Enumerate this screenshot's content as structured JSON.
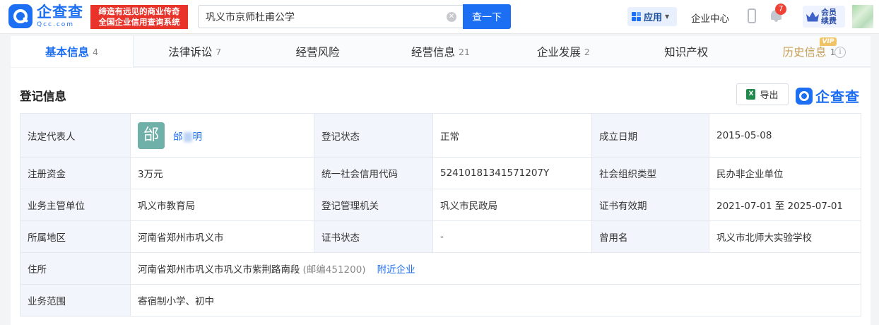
{
  "header": {
    "logo_cn": "企查查",
    "logo_en": "Qcc.com",
    "slogan_line1": "缔造有远见的商业传奇",
    "slogan_line2": "全国企业信用查询系统",
    "search_value": "巩义市京师杜甫公学",
    "search_button": "查一下",
    "app_label": "应用",
    "enterprise_center": "企业中心",
    "notification_count": "7",
    "vip_line1": "会员",
    "vip_line2": "续费"
  },
  "tabs": [
    {
      "label": "基本信息",
      "count": "4"
    },
    {
      "label": "法律诉讼",
      "count": "7"
    },
    {
      "label": "经营风险",
      "count": ""
    },
    {
      "label": "经营信息",
      "count": "21"
    },
    {
      "label": "企业发展",
      "count": "2"
    },
    {
      "label": "知识产权",
      "count": ""
    },
    {
      "label": "历史信息",
      "count": "1"
    }
  ],
  "vip_tag": "VIP",
  "section": {
    "title": "登记信息",
    "export_label": "导出",
    "brand": "企查查"
  },
  "registration": {
    "legal_rep_label": "法定代表人",
    "legal_rep_avatar": "邰",
    "legal_rep_first": "邰",
    "legal_rep_last": "明",
    "reg_status_label": "登记状态",
    "reg_status": "正常",
    "founded_label": "成立日期",
    "founded": "2015-05-08",
    "capital_label": "注册资金",
    "capital": "3万元",
    "credit_code_label": "统一社会信用代码",
    "credit_code": "52410181341571207Y",
    "org_type_label": "社会组织类型",
    "org_type": "民办非企业单位",
    "supervisor_label": "业务主管单位",
    "supervisor": "巩义市教育局",
    "reg_authority_label": "登记管理机关",
    "reg_authority": "巩义市民政局",
    "cert_valid_label": "证书有效期",
    "cert_valid": "2021-07-01 至 2025-07-01",
    "region_label": "所属地区",
    "region": "河南省郑州市巩义市",
    "cert_status_label": "证书状态",
    "cert_status": "-",
    "former_name_label": "曾用名",
    "former_name": "巩义市北师大实验学校",
    "address_label": "住所",
    "address": "河南省郑州市巩义市巩义市紫荆路南段",
    "postcode": "(邮编451200)",
    "nearby_link": "附近企业",
    "scope_label": "业务范围",
    "scope": "寄宿制小学、初中"
  }
}
